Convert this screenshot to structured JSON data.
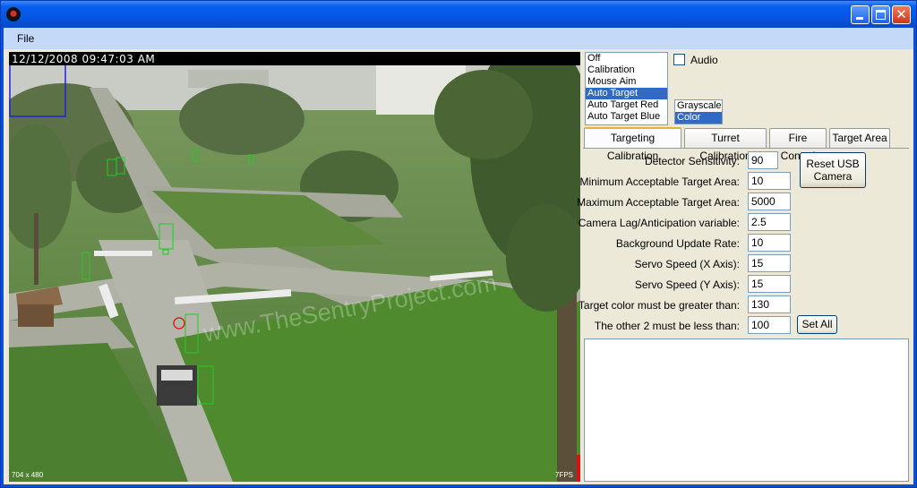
{
  "window": {
    "title": ""
  },
  "menu": {
    "file": "File"
  },
  "camera": {
    "timestamp": "12/12/2008 09:47:03 AM",
    "resolution": "704 x 480",
    "fps": "7FPS",
    "watermark": "www.TheSentryProject.com"
  },
  "modes": {
    "items": [
      "Off",
      "Calibration",
      "Mouse Aim",
      "Auto Target",
      "Auto Target Red",
      "Auto Target Blue"
    ],
    "selected": "Auto Target"
  },
  "color_modes": {
    "items": [
      "Grayscale",
      "Color"
    ],
    "selected": "Color"
  },
  "audio": {
    "label": "Audio",
    "checked": false
  },
  "tabs": [
    {
      "label": "Targeting Calibration",
      "active": true
    },
    {
      "label": "Turret Calibration",
      "active": false
    },
    {
      "label": "Fire Control",
      "active": false
    },
    {
      "label": "Target Area",
      "active": false
    }
  ],
  "fields": [
    {
      "label": "Detector Sensitivity:",
      "value": "90"
    },
    {
      "label": "Minimum Acceptable Target Area:",
      "value": "10"
    },
    {
      "label": "Maximum Acceptable Target Area:",
      "value": "5000"
    },
    {
      "label": "Camera Lag/Anticipation variable:",
      "value": "2.5"
    },
    {
      "label": "Background Update Rate:",
      "value": "10"
    },
    {
      "label": "Servo Speed (X Axis):",
      "value": "15"
    },
    {
      "label": "Servo Speed (Y Axis):",
      "value": "15"
    },
    {
      "label": "Target color must be greater than:",
      "value": "130"
    },
    {
      "label": "The other 2 must be less than:",
      "value": "100"
    }
  ],
  "buttons": {
    "reset_camera_line1": "Reset USB",
    "reset_camera_line2": "Camera",
    "set_all": "Set All"
  },
  "output_log": ""
}
